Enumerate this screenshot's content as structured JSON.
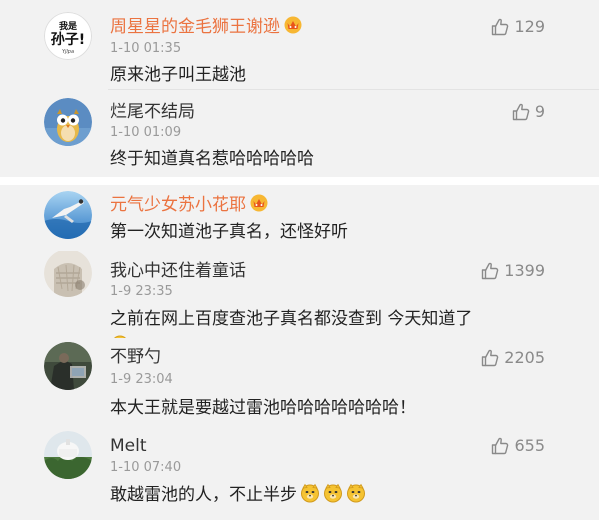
{
  "comments": [
    {
      "username": "周星星的金毛狮王谢逊",
      "username_color": "#eb7340",
      "vip": true,
      "avatar_text": [
        "我是",
        "孙子!",
        "Yjlpa"
      ],
      "timestamp": "1-10 01:35",
      "text": "原来池子叫王越池",
      "likes": "129"
    },
    {
      "username": "烂尾不结局",
      "vip": false,
      "timestamp": "1-10 01:09",
      "text": "终于知道真名惹哈哈哈哈哈",
      "likes": "9"
    },
    {
      "username": "元气少女苏小花耶",
      "username_color": "#eb7340",
      "vip": true,
      "text": "第一次知道池子真名，还怪好听"
    },
    {
      "username": "我心中还住着童话",
      "vip": false,
      "timestamp": "1-9 23:35",
      "text": "之前在网上百度查池子真名都没查到 今天知道了",
      "likes": "1399"
    },
    {
      "username": "不野勺",
      "vip": false,
      "timestamp": "1-9 23:04",
      "text": "本大王就是要越过雷池哈哈哈哈哈哈哈！",
      "likes": "2205"
    },
    {
      "username": "Melt",
      "vip": false,
      "timestamp": "1-10 07:40",
      "text": "敢越雷池的人，不止半步",
      "emojis": [
        "doge-emoji",
        "doge-emoji",
        "doge-emoji"
      ],
      "likes": "655"
    }
  ],
  "colors": {
    "background": "#f2f2f2",
    "vip_name": "#eb7340",
    "timestamp": "#9a9a9a",
    "like": "#8a8a8a"
  },
  "icons": {
    "like": "thumbs-up-icon",
    "vip": "vip-crown-badge-icon"
  }
}
